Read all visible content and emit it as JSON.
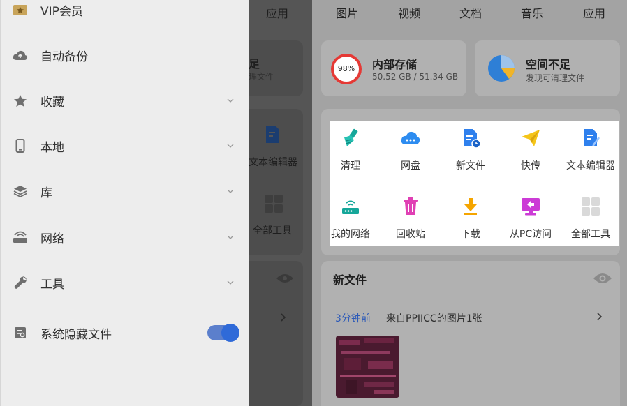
{
  "drawer": {
    "vip_label": "VIP会员",
    "items": [
      {
        "label": "自动备份"
      },
      {
        "label": "收藏"
      },
      {
        "label": "本地"
      },
      {
        "label": "库"
      },
      {
        "label": "网络"
      },
      {
        "label": "工具"
      },
      {
        "label": "系统隐藏文件"
      }
    ],
    "hidden_files_toggle_on": true
  },
  "covered": {
    "tab_apps": "应用",
    "storage_char": "足",
    "storage_sub": "理文件",
    "editor_label": "文本编辑器",
    "all_tools_label": "全部工具"
  },
  "tabs": [
    "图片",
    "视频",
    "文档",
    "音乐",
    "应用"
  ],
  "storage": {
    "internal_title": "内部存储",
    "internal_percent": "98%",
    "internal_usage": "50.52 GB / 51.34 GB",
    "space_title": "空间不足",
    "space_sub": "发现可清理文件"
  },
  "tools": [
    {
      "label": "清理",
      "icon": "broom-icon"
    },
    {
      "label": "网盘",
      "icon": "cloud-drive-icon"
    },
    {
      "label": "新文件",
      "icon": "new-file-icon"
    },
    {
      "label": "快传",
      "icon": "paper-plane-icon"
    },
    {
      "label": "文本编辑器",
      "icon": "text-editor-icon"
    },
    {
      "label": "我的网络",
      "icon": "router-icon"
    },
    {
      "label": "回收站",
      "icon": "trash-icon"
    },
    {
      "label": "下载",
      "icon": "download-icon"
    },
    {
      "label": "从PC访问",
      "icon": "pc-access-icon"
    },
    {
      "label": "全部工具",
      "icon": "all-tools-icon"
    }
  ],
  "new_files": {
    "title": "新文件",
    "time": "3分钟前",
    "desc": "来自PPIICC的图片1张"
  },
  "colors": {
    "accent": "#2f6ad8",
    "storage_ring": "#e53935",
    "pie_blue": "#2e7fd6",
    "pie_yellow": "#f0b429"
  }
}
